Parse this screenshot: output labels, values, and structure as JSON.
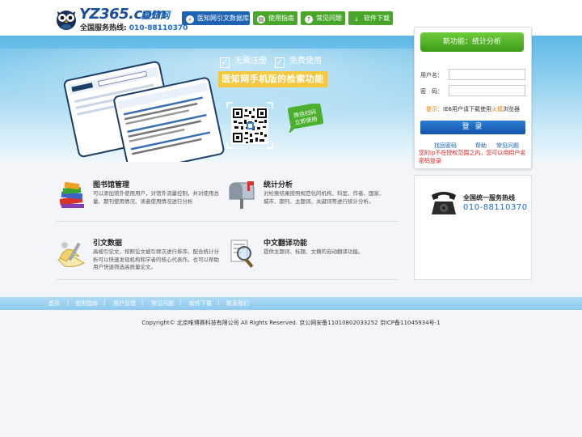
{
  "header": {
    "logo_text": "YZ365.com",
    "logo_sub": "医知网",
    "hotline_label": "全国服务热线:",
    "hotline_number": "010-88110370",
    "nav": [
      {
        "label": "医知网引文数据库",
        "icon": "search-icon"
      },
      {
        "label": "使用指南",
        "icon": "book-icon"
      },
      {
        "label": "常见问题",
        "icon": "question-icon"
      },
      {
        "label": "软件下载",
        "icon": "download-icon"
      }
    ]
  },
  "banner": {
    "tag_no_register": "无需注册",
    "tag_free": "免费使用",
    "mobile_title": "医知网手机版的检索功能",
    "scan_badge_line1": "微信扫码",
    "scan_badge_line2": "立即使用"
  },
  "login": {
    "new_feature": "新功能：统计分析",
    "username_label": "用户名：",
    "password_label": "密　码：",
    "username_value": "",
    "password_value": "",
    "tip_prefix": "提示：",
    "tip_text": "IE6用户请下载使用",
    "tip_browser": "火狐",
    "tip_suffix": "浏览器",
    "login_button": "登 录",
    "forgot_password": "找回密码",
    "help": "帮助",
    "faq": "常见问题",
    "ip_warning": "您的ip不在授权范围之内，您可以用用户名密码登录"
  },
  "features": [
    {
      "title": "图书馆管理",
      "desc": "可以添加馆外使用用户，对馆外流量控制，并对使用总量、期刊使用情况、读者使用情况进行分析",
      "icon": "library-books-icon"
    },
    {
      "title": "统计分析",
      "desc": "对检索结果按照规范化的机构、科室、作者、国家、城市、期刊、主题词、关键词等进行统计分析。",
      "icon": "mailbox-icon"
    },
    {
      "title": "引文数据",
      "desc": "高被引论文，按照论文被引频次进行排序。配合统计分析可以快速发现机构和学者的核心代表作。也可以帮助用户快速筛选高质量论文。",
      "icon": "notebook-pen-icon"
    },
    {
      "title": "中文翻译功能",
      "desc": "提供主题词、标题、文摘的自动翻译功能。",
      "icon": "magnifier-icon"
    }
  ],
  "hotline_box": {
    "label": "全国统一服务热线",
    "number": "010-88110370",
    "icon": "telephone-icon"
  },
  "footer": {
    "nav": [
      "首页",
      "使用指南",
      "用户反馈",
      "常见问题",
      "软件下载",
      "联系我们"
    ],
    "copyright": "Copyright© 北京唯博赛科技有限公司 All Rights Reserved. 京公网安备11010802033252 京ICP备11045934号-1"
  },
  "colors": {
    "primary_blue": "#1f63b5",
    "nav_green": "#4aa52b",
    "banner_blue": "#5db8e6",
    "banner_yellow": "#f5c842",
    "warning_red": "#e02020",
    "accent_orange": "#e37b00"
  }
}
